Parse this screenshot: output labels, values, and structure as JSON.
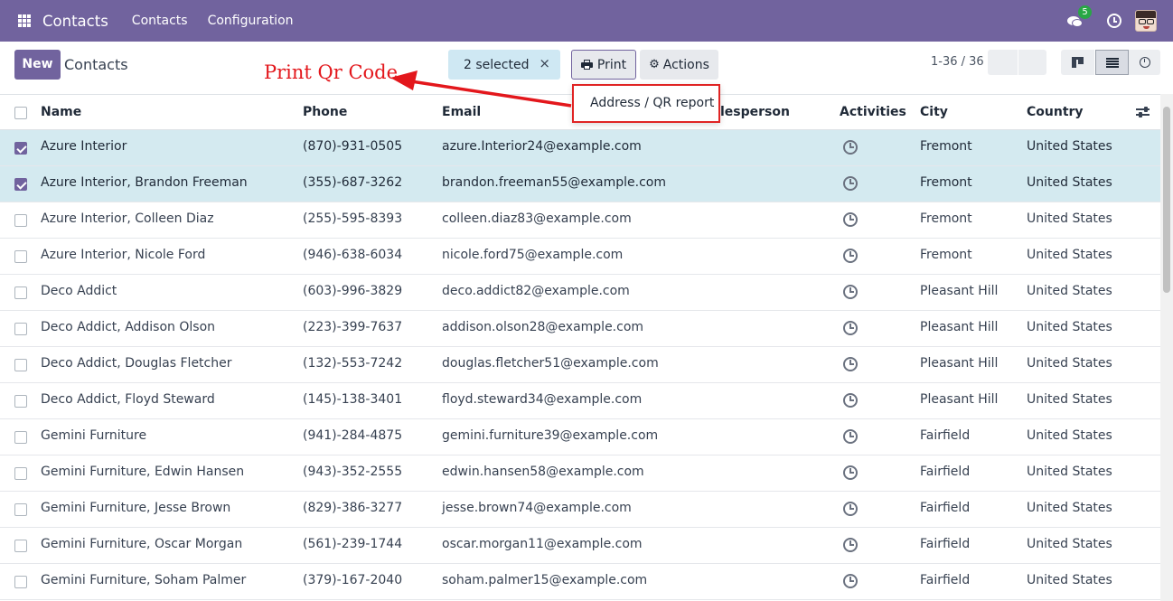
{
  "navbar": {
    "brand": "Contacts",
    "menu": [
      "Contacts",
      "Configuration"
    ],
    "chat_badge": "5"
  },
  "control": {
    "new_label": "New",
    "breadcrumb": "Contacts",
    "selected_label": "2 selected",
    "clear_symbol": "×",
    "print_label": "Print",
    "actions_label": "Actions",
    "pager": "1-36 / 36"
  },
  "dropdown": {
    "item": "Address / QR report"
  },
  "annotation": {
    "text": "Print Qr Code",
    "color": "#e3171c"
  },
  "table": {
    "headers": {
      "name": "Name",
      "phone": "Phone",
      "email": "Email",
      "salesperson": "lesperson",
      "activities": "Activities",
      "city": "City",
      "country": "Country"
    },
    "rows": [
      {
        "name": "Azure Interior",
        "phone": "(870)-931-0505",
        "email": "azure.Interior24@example.com",
        "city": "Fremont",
        "country": "United States",
        "selected": true
      },
      {
        "name": "Azure Interior, Brandon Freeman",
        "phone": "(355)-687-3262",
        "email": "brandon.freeman55@example.com",
        "city": "Fremont",
        "country": "United States",
        "selected": true
      },
      {
        "name": "Azure Interior, Colleen Diaz",
        "phone": "(255)-595-8393",
        "email": "colleen.diaz83@example.com",
        "city": "Fremont",
        "country": "United States",
        "selected": false
      },
      {
        "name": "Azure Interior, Nicole Ford",
        "phone": "(946)-638-6034",
        "email": "nicole.ford75@example.com",
        "city": "Fremont",
        "country": "United States",
        "selected": false
      },
      {
        "name": "Deco Addict",
        "phone": "(603)-996-3829",
        "email": "deco.addict82@example.com",
        "city": "Pleasant Hill",
        "country": "United States",
        "selected": false
      },
      {
        "name": "Deco Addict, Addison Olson",
        "phone": "(223)-399-7637",
        "email": "addison.olson28@example.com",
        "city": "Pleasant Hill",
        "country": "United States",
        "selected": false
      },
      {
        "name": "Deco Addict, Douglas Fletcher",
        "phone": "(132)-553-7242",
        "email": "douglas.fletcher51@example.com",
        "city": "Pleasant Hill",
        "country": "United States",
        "selected": false
      },
      {
        "name": "Deco Addict, Floyd Steward",
        "phone": "(145)-138-3401",
        "email": "floyd.steward34@example.com",
        "city": "Pleasant Hill",
        "country": "United States",
        "selected": false
      },
      {
        "name": "Gemini Furniture",
        "phone": "(941)-284-4875",
        "email": "gemini.furniture39@example.com",
        "city": "Fairfield",
        "country": "United States",
        "selected": false
      },
      {
        "name": "Gemini Furniture, Edwin Hansen",
        "phone": "(943)-352-2555",
        "email": "edwin.hansen58@example.com",
        "city": "Fairfield",
        "country": "United States",
        "selected": false
      },
      {
        "name": "Gemini Furniture, Jesse Brown",
        "phone": "(829)-386-3277",
        "email": "jesse.brown74@example.com",
        "city": "Fairfield",
        "country": "United States",
        "selected": false
      },
      {
        "name": "Gemini Furniture, Oscar Morgan",
        "phone": "(561)-239-1744",
        "email": "oscar.morgan11@example.com",
        "city": "Fairfield",
        "country": "United States",
        "selected": false
      },
      {
        "name": "Gemini Furniture, Soham Palmer",
        "phone": "(379)-167-2040",
        "email": "soham.palmer15@example.com",
        "city": "Fairfield",
        "country": "United States",
        "selected": false
      }
    ]
  },
  "colors": {
    "brand": "#71639e",
    "selected_row": "#d4eaf0",
    "selected_pill": "#cfe8f3",
    "annotation_red": "#e3171c"
  }
}
